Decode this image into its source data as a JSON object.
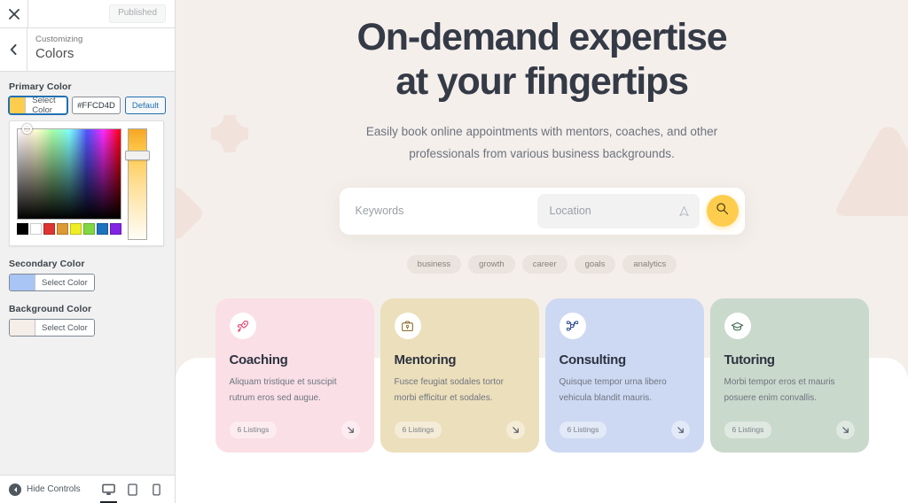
{
  "customizer": {
    "close_icon": "close-icon",
    "published_label": "Published",
    "back_icon": "chevron-left-icon",
    "breadcrumb": "Customizing",
    "panel_title": "Colors",
    "controls": [
      {
        "label": "Primary Color",
        "select_label": "Select Color",
        "swatch": "#FFCD4D",
        "hex_value": "#FFCD4D",
        "default_label": "Default",
        "picker_open": true
      },
      {
        "label": "Secondary Color",
        "select_label": "Select Color",
        "swatch": "#A8C5F5",
        "picker_open": false
      },
      {
        "label": "Background Color",
        "select_label": "Select Color",
        "swatch": "#F5EDE8",
        "picker_open": false
      }
    ],
    "palette": [
      "#000000",
      "#ffffff",
      "#dd3333",
      "#dd9933",
      "#eeee22",
      "#81d742",
      "#1e73be",
      "#8224e3"
    ],
    "footer": {
      "hide_controls_label": "Hide Controls",
      "hide_controls_icon": "collapse-left-icon",
      "devices": [
        {
          "name": "desktop",
          "icon": "desktop-icon",
          "active": true
        },
        {
          "name": "tablet",
          "icon": "tablet-icon",
          "active": false
        },
        {
          "name": "mobile",
          "icon": "mobile-icon",
          "active": false
        }
      ]
    }
  },
  "preview": {
    "hero": {
      "title_line1": "On-demand expertise",
      "title_line2": "at your fingertips",
      "subtitle_line1": "Easily book online appointments with mentors, coaches, and other",
      "subtitle_line2": "professionals from various business backgrounds."
    },
    "search": {
      "keywords_placeholder": "Keywords",
      "location_placeholder": "Location",
      "location_icon": "navigation-arrow-icon",
      "search_icon": "search-icon",
      "button_color": "#FFCD4D"
    },
    "tags": [
      "business",
      "growth",
      "career",
      "goals",
      "analytics"
    ],
    "cards": [
      {
        "icon": "rocket-icon",
        "title": "Coaching",
        "desc_line1": "Aliquam tristique et suscipit",
        "desc_line2": "rutrum eros sed augue.",
        "listings": "6 Listings",
        "arrow_icon": "arrow-down-right-icon",
        "bg": "#fadfe6",
        "icon_color": "#e8446f"
      },
      {
        "icon": "briefcase-icon",
        "title": "Mentoring",
        "desc_line1": "Fusce feugiat sodales tortor",
        "desc_line2": "morbi efficitur et sodales.",
        "listings": "6 Listings",
        "arrow_icon": "arrow-down-right-icon",
        "bg": "#ecdfbb",
        "icon_color": "#8a6e2a"
      },
      {
        "icon": "sitemap-icon",
        "title": "Consulting",
        "desc_line1": "Quisque tempor urna libero",
        "desc_line2": "vehicula blandit mauris.",
        "listings": "6 Listings",
        "arrow_icon": "arrow-down-right-icon",
        "bg": "#cdd9f2",
        "icon_color": "#2d4b8e"
      },
      {
        "icon": "graduation-cap-icon",
        "title": "Tutoring",
        "desc_line1": "Morbi tempor eros et mauris",
        "desc_line2": "posuere enim convallis.",
        "listings": "6 Listings",
        "arrow_icon": "arrow-down-right-icon",
        "bg": "#c9d9cb",
        "icon_color": "#3e6b4d"
      }
    ]
  }
}
